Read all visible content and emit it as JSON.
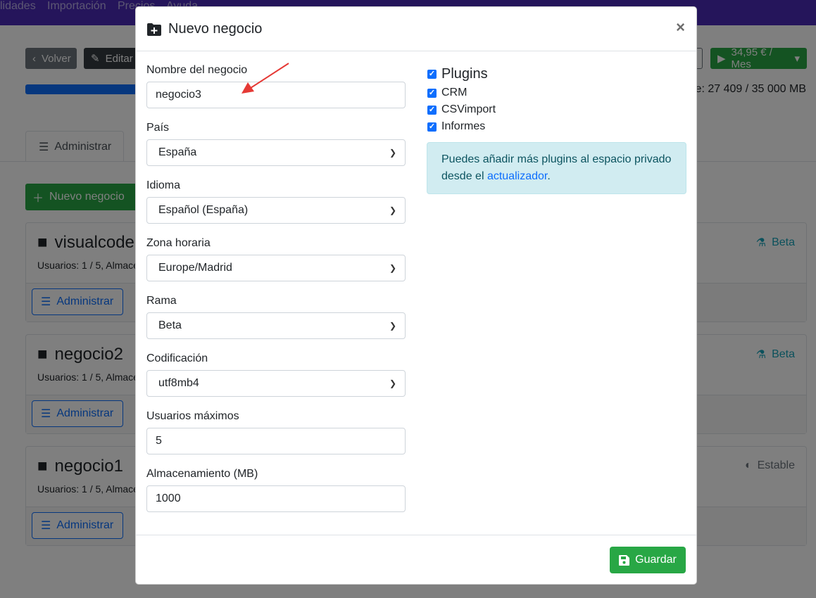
{
  "topnav": {
    "items": [
      "lidades",
      "Importación",
      "Precios",
      "Ayuda"
    ]
  },
  "background": {
    "back_label": "Volver",
    "edit_label": "Editar",
    "price_label": "34,95 € / Mes",
    "storage_text": "e: 27 409 / 35 000 MB",
    "tab_admin": "Administrar",
    "new_business_label": "Nuevo negocio",
    "cards": [
      {
        "name": "visualcode",
        "info": "Usuarios: 1 / 5, Almace",
        "badge": "Beta",
        "admin_label": "Administrar"
      },
      {
        "name": "negocio2",
        "info": "Usuarios: 1 / 5, Almace",
        "badge": "Beta",
        "admin_label": "Administrar"
      },
      {
        "name": "negocio1",
        "info": "Usuarios: 1 / 5, Almace",
        "badge": "Estable",
        "admin_label": "Administrar"
      }
    ]
  },
  "modal": {
    "title": "Nuevo negocio",
    "close": "×",
    "fields": {
      "name_label": "Nombre del negocio",
      "name_value": "negocio3",
      "country_label": "País",
      "country_value": "España",
      "language_label": "Idioma",
      "language_value": "Español (España)",
      "timezone_label": "Zona horaria",
      "timezone_value": "Europe/Madrid",
      "branch_label": "Rama",
      "branch_value": "Beta",
      "encoding_label": "Codificación",
      "encoding_value": "utf8mb4",
      "max_users_label": "Usuarios máximos",
      "max_users_value": "5",
      "storage_label": "Almacenamiento (MB)",
      "storage_value": "1000"
    },
    "plugins": {
      "heading": "Plugins",
      "items": [
        "CRM",
        "CSVimport",
        "Informes"
      ]
    },
    "alert": {
      "text_before": "Puedes añadir más plugins al espacio privado desde el ",
      "link": "actualizador",
      "text_after": "."
    },
    "save_label": "Guardar"
  },
  "colors": {
    "primary": "#0d6efd",
    "success": "#28a745",
    "nav": "#4a2bb6",
    "info_bg": "#d1ecf1"
  }
}
